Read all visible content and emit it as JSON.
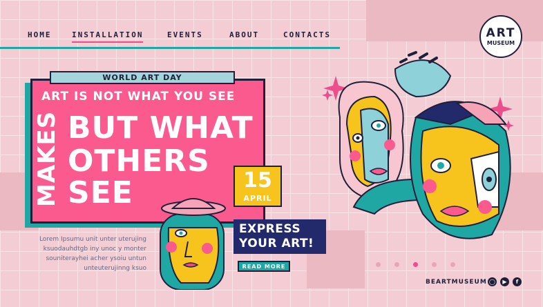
{
  "nav": {
    "items": [
      {
        "label": "HOME"
      },
      {
        "label": "INSTALLATION"
      },
      {
        "label": "EVENTS"
      },
      {
        "label": "ABOUT"
      },
      {
        "label": "CONTACTS"
      }
    ],
    "active_index": 1
  },
  "logo": {
    "line1": "ART",
    "line2": "MUSEUM"
  },
  "hero": {
    "tag": "WORLD ART DAY",
    "line1": "ART IS NOT WHAT YOU SEE",
    "big1": "BUT WHAT",
    "big2": "OTHERS",
    "big3": "SEE",
    "vertical": "MAKES"
  },
  "date": {
    "day": "15",
    "month": "APRIL"
  },
  "cta": {
    "express1": "EXPRESS",
    "express2": "YOUR ART!",
    "read_more": "READ MORE"
  },
  "lorem": [
    "Lorem Ipsumu unit unter uterujing",
    "ksuodauhdtgb iny unoc y monter",
    "souniterayhei acher ysoiu untun",
    "unteuterujinng ksuo"
  ],
  "carousel": {
    "count": 5,
    "active_index": 2
  },
  "footer": {
    "brand": "BEARTMUSEUM"
  },
  "social": [
    "instagram-icon",
    "youtube-icon",
    "facebook-icon"
  ],
  "colors": {
    "background": "#f3cdd3",
    "pink": "#fb5a8f",
    "teal": "#1fa7a3",
    "navy": "#232a6b",
    "yellow": "#f6c41c",
    "light_blue": "#a4d5dc"
  }
}
